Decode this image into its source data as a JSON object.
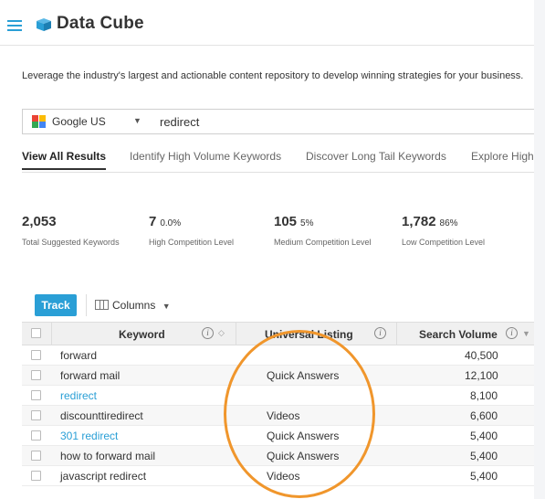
{
  "header": {
    "title": "Data Cube"
  },
  "description": "Leverage the industry's largest and actionable content repository to develop winning strategies for your business.",
  "search": {
    "engine": "Google US",
    "query": "redirect"
  },
  "tabs": [
    {
      "label": "View All Results",
      "active": true
    },
    {
      "label": "Identify High Volume Keywords",
      "active": false
    },
    {
      "label": "Discover Long Tail Keywords",
      "active": false
    },
    {
      "label": "Explore High V",
      "active": false
    }
  ],
  "stats": [
    {
      "value": "2,053",
      "percent": "",
      "label": "Total Suggested Keywords"
    },
    {
      "value": "7",
      "percent": "0.0%",
      "label": "High Competition Level"
    },
    {
      "value": "105",
      "percent": "5%",
      "label": "Medium Competition Level"
    },
    {
      "value": "1,782",
      "percent": "86%",
      "label": "Low Competition Level"
    }
  ],
  "toolbar": {
    "track_label": "Track",
    "columns_label": "Columns"
  },
  "table": {
    "headers": {
      "keyword": "Keyword",
      "universal_listing": "Universal Listing",
      "search_volume": "Search Volume"
    },
    "rows": [
      {
        "keyword": "forward",
        "listing": "",
        "volume": "40,500",
        "link": false
      },
      {
        "keyword": "forward mail",
        "listing": "Quick Answers",
        "volume": "12,100",
        "link": false
      },
      {
        "keyword": "redirect",
        "listing": "",
        "volume": "8,100",
        "link": true
      },
      {
        "keyword": "discounttiredirect",
        "listing": "Videos",
        "volume": "6,600",
        "link": false
      },
      {
        "keyword": "301 redirect",
        "listing": "Quick Answers",
        "volume": "5,400",
        "link": true
      },
      {
        "keyword": "how to forward mail",
        "listing": "Quick Answers",
        "volume": "5,400",
        "link": false
      },
      {
        "keyword": "javascript redirect",
        "listing": "Videos",
        "volume": "5,400",
        "link": false
      }
    ]
  },
  "colors": {
    "accent": "#2a9fd6",
    "annotation": "#f0962c"
  }
}
